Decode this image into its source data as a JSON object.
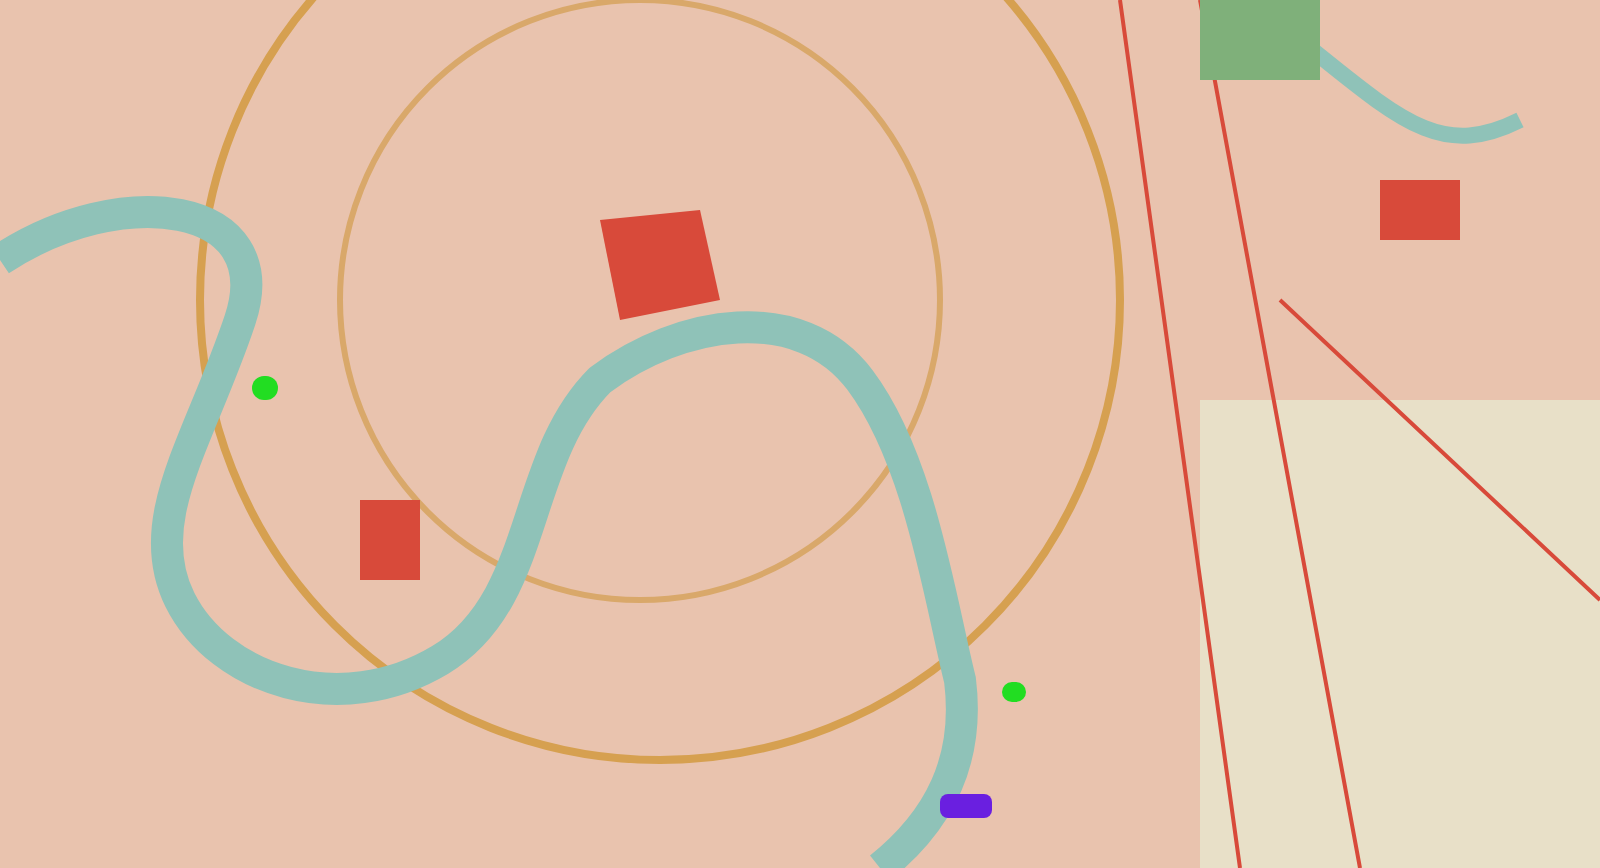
{
  "map": {
    "markers": [
      {
        "kind": "dot",
        "color": "#22dd22"
      },
      {
        "kind": "dot",
        "color": "#22dd22"
      },
      {
        "kind": "blob",
        "color": "#6a1fe0"
      }
    ]
  }
}
